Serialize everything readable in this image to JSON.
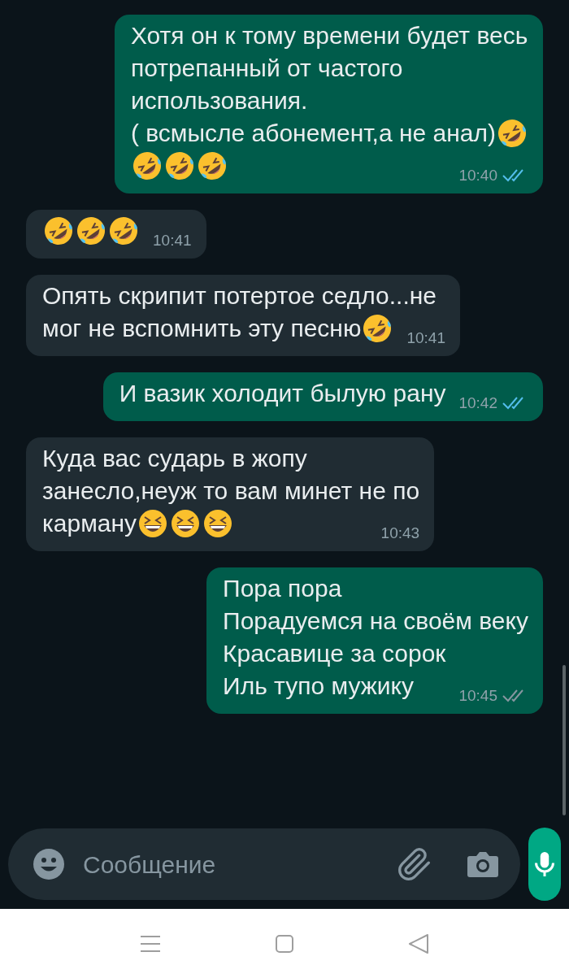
{
  "messages": [
    {
      "outgoing": true,
      "lines": [
        {
          "text": "Хотя он к тому времени будет весь"
        },
        {
          "text": "потрепанный от частого"
        },
        {
          "text": "использования."
        },
        {
          "text": "( всмысле абонемент,а не анал)",
          "emojis": [
            {
              "kind": "rofl"
            }
          ]
        },
        {
          "emojis": [
            {
              "kind": "rofl"
            },
            {
              "kind": "rofl"
            },
            {
              "kind": "rofl"
            }
          ]
        }
      ],
      "time": "10:40",
      "read": true
    },
    {
      "outgoing": false,
      "lines": [
        {
          "emojis": [
            {
              "kind": "rofl"
            },
            {
              "kind": "rofl"
            },
            {
              "kind": "rofl"
            }
          ]
        }
      ],
      "time": "10:41"
    },
    {
      "outgoing": false,
      "lines": [
        {
          "text": "Опять скрипит потертое седло...не"
        },
        {
          "text": "мог не вспомнить эту песню",
          "emojis": [
            {
              "kind": "rofl"
            }
          ]
        }
      ],
      "time": "10:41"
    },
    {
      "outgoing": true,
      "lines": [
        {
          "text": "И вазик холодит былую рану"
        }
      ],
      "time": "10:42",
      "read": true
    },
    {
      "outgoing": false,
      "lines": [
        {
          "text": "Куда вас сударь в жопу"
        },
        {
          "text": "занесло,неуж то вам минет не по"
        },
        {
          "text": "карману",
          "emojis": [
            {
              "kind": "grin"
            },
            {
              "kind": "grin"
            },
            {
              "kind": "grin"
            }
          ]
        }
      ],
      "time": "10:43"
    },
    {
      "outgoing": true,
      "lines": [
        {
          "text": "Пора пора"
        },
        {
          "text": "Порадуемся на своём веку"
        },
        {
          "text": "Красавице за сорок"
        },
        {
          "text": "Иль тупо мужику"
        }
      ],
      "time": "10:45",
      "read": false
    }
  ],
  "composer": {
    "placeholder": "Сообщение"
  }
}
